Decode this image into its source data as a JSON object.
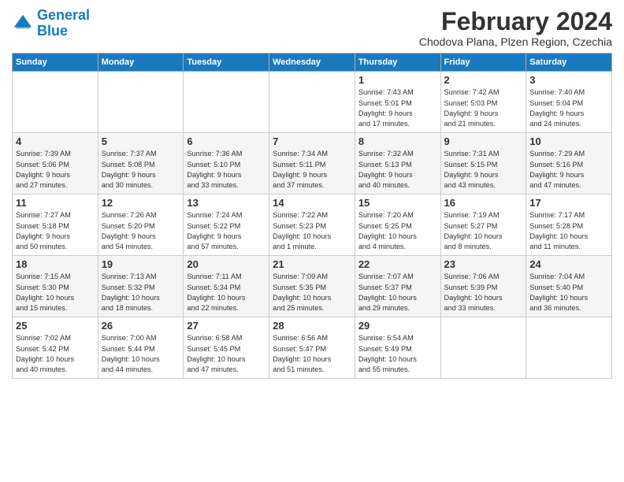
{
  "logo": {
    "text1": "General",
    "text2": "Blue"
  },
  "title": "February 2024",
  "subtitle": "Chodova Plana, Plzen Region, Czechia",
  "days_header": [
    "Sunday",
    "Monday",
    "Tuesday",
    "Wednesday",
    "Thursday",
    "Friday",
    "Saturday"
  ],
  "weeks": [
    [
      {
        "day": "",
        "info": ""
      },
      {
        "day": "",
        "info": ""
      },
      {
        "day": "",
        "info": ""
      },
      {
        "day": "",
        "info": ""
      },
      {
        "day": "1",
        "info": "Sunrise: 7:43 AM\nSunset: 5:01 PM\nDaylight: 9 hours\nand 17 minutes."
      },
      {
        "day": "2",
        "info": "Sunrise: 7:42 AM\nSunset: 5:03 PM\nDaylight: 9 hours\nand 21 minutes."
      },
      {
        "day": "3",
        "info": "Sunrise: 7:40 AM\nSunset: 5:04 PM\nDaylight: 9 hours\nand 24 minutes."
      }
    ],
    [
      {
        "day": "4",
        "info": "Sunrise: 7:39 AM\nSunset: 5:06 PM\nDaylight: 9 hours\nand 27 minutes."
      },
      {
        "day": "5",
        "info": "Sunrise: 7:37 AM\nSunset: 5:08 PM\nDaylight: 9 hours\nand 30 minutes."
      },
      {
        "day": "6",
        "info": "Sunrise: 7:36 AM\nSunset: 5:10 PM\nDaylight: 9 hours\nand 33 minutes."
      },
      {
        "day": "7",
        "info": "Sunrise: 7:34 AM\nSunset: 5:11 PM\nDaylight: 9 hours\nand 37 minutes."
      },
      {
        "day": "8",
        "info": "Sunrise: 7:32 AM\nSunset: 5:13 PM\nDaylight: 9 hours\nand 40 minutes."
      },
      {
        "day": "9",
        "info": "Sunrise: 7:31 AM\nSunset: 5:15 PM\nDaylight: 9 hours\nand 43 minutes."
      },
      {
        "day": "10",
        "info": "Sunrise: 7:29 AM\nSunset: 5:16 PM\nDaylight: 9 hours\nand 47 minutes."
      }
    ],
    [
      {
        "day": "11",
        "info": "Sunrise: 7:27 AM\nSunset: 5:18 PM\nDaylight: 9 hours\nand 50 minutes."
      },
      {
        "day": "12",
        "info": "Sunrise: 7:26 AM\nSunset: 5:20 PM\nDaylight: 9 hours\nand 54 minutes."
      },
      {
        "day": "13",
        "info": "Sunrise: 7:24 AM\nSunset: 5:22 PM\nDaylight: 9 hours\nand 57 minutes."
      },
      {
        "day": "14",
        "info": "Sunrise: 7:22 AM\nSunset: 5:23 PM\nDaylight: 10 hours\nand 1 minute."
      },
      {
        "day": "15",
        "info": "Sunrise: 7:20 AM\nSunset: 5:25 PM\nDaylight: 10 hours\nand 4 minutes."
      },
      {
        "day": "16",
        "info": "Sunrise: 7:19 AM\nSunset: 5:27 PM\nDaylight: 10 hours\nand 8 minutes."
      },
      {
        "day": "17",
        "info": "Sunrise: 7:17 AM\nSunset: 5:28 PM\nDaylight: 10 hours\nand 11 minutes."
      }
    ],
    [
      {
        "day": "18",
        "info": "Sunrise: 7:15 AM\nSunset: 5:30 PM\nDaylight: 10 hours\nand 15 minutes."
      },
      {
        "day": "19",
        "info": "Sunrise: 7:13 AM\nSunset: 5:32 PM\nDaylight: 10 hours\nand 18 minutes."
      },
      {
        "day": "20",
        "info": "Sunrise: 7:11 AM\nSunset: 5:34 PM\nDaylight: 10 hours\nand 22 minutes."
      },
      {
        "day": "21",
        "info": "Sunrise: 7:09 AM\nSunset: 5:35 PM\nDaylight: 10 hours\nand 25 minutes."
      },
      {
        "day": "22",
        "info": "Sunrise: 7:07 AM\nSunset: 5:37 PM\nDaylight: 10 hours\nand 29 minutes."
      },
      {
        "day": "23",
        "info": "Sunrise: 7:06 AM\nSunset: 5:39 PM\nDaylight: 10 hours\nand 33 minutes."
      },
      {
        "day": "24",
        "info": "Sunrise: 7:04 AM\nSunset: 5:40 PM\nDaylight: 10 hours\nand 36 minutes."
      }
    ],
    [
      {
        "day": "25",
        "info": "Sunrise: 7:02 AM\nSunset: 5:42 PM\nDaylight: 10 hours\nand 40 minutes."
      },
      {
        "day": "26",
        "info": "Sunrise: 7:00 AM\nSunset: 5:44 PM\nDaylight: 10 hours\nand 44 minutes."
      },
      {
        "day": "27",
        "info": "Sunrise: 6:58 AM\nSunset: 5:45 PM\nDaylight: 10 hours\nand 47 minutes."
      },
      {
        "day": "28",
        "info": "Sunrise: 6:56 AM\nSunset: 5:47 PM\nDaylight: 10 hours\nand 51 minutes."
      },
      {
        "day": "29",
        "info": "Sunrise: 6:54 AM\nSunset: 5:49 PM\nDaylight: 10 hours\nand 55 minutes."
      },
      {
        "day": "",
        "info": ""
      },
      {
        "day": "",
        "info": ""
      }
    ]
  ]
}
